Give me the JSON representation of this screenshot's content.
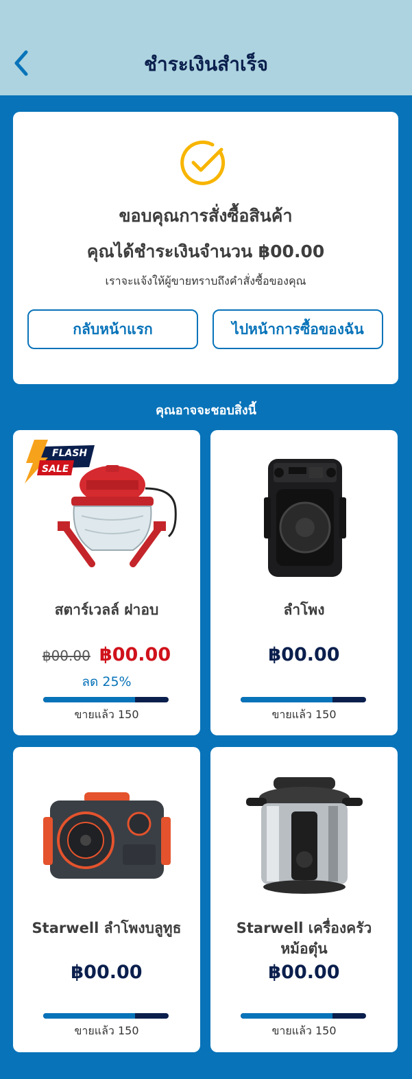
{
  "header": {
    "title": "ชำระเงินสำเร็จ",
    "back_icon": "chevron-left-icon"
  },
  "success": {
    "icon": "check-circle-icon",
    "thanks": "ขอบคุณการสั่งซื้อสินค้า",
    "paid_text": "คุณได้ชำระเงินจำนวน ฿00.00",
    "notify_text": "เราจะแจ้งให้ผู้ขายทราบถึงคำสั่งซื้อของคุณ",
    "home_button": "กลับหน้าแรก",
    "orders_button": "ไปหน้าการซื้อของฉัน"
  },
  "recommend": {
    "title": "คุณอาจจะชอบสิ่งนี้",
    "products": [
      {
        "name": "สตาร์เวลล์ ฝาอบ",
        "old_price": "฿00.00",
        "price": "฿00.00",
        "discount": "ลด 25%",
        "sold": "ขายแล้ว 150",
        "progress": 0.73,
        "badge_line1": "FLASH",
        "badge_line2": "SALE"
      },
      {
        "name": "ลำโพง",
        "price": "฿00.00",
        "sold": "ขายแล้ว 150",
        "progress": 0.73
      },
      {
        "name": "Starwell ลำโพงบลูทูธ",
        "price": "฿00.00",
        "sold": "ขายแล้ว 150",
        "progress": 0.73
      },
      {
        "name_line1": "Starwell เครื่องครัว",
        "name_line2": "หม้อตุ๋น",
        "price": "฿00.00",
        "sold": "ขายแล้ว 150",
        "progress": 0.73
      }
    ]
  },
  "colors": {
    "header_bg": "#acd3df",
    "page_bg": "#0873b9",
    "accent": "#0873b9",
    "navy": "#0b1f4d",
    "sale_red": "#d0121b",
    "check_yellow": "#f7b500"
  }
}
